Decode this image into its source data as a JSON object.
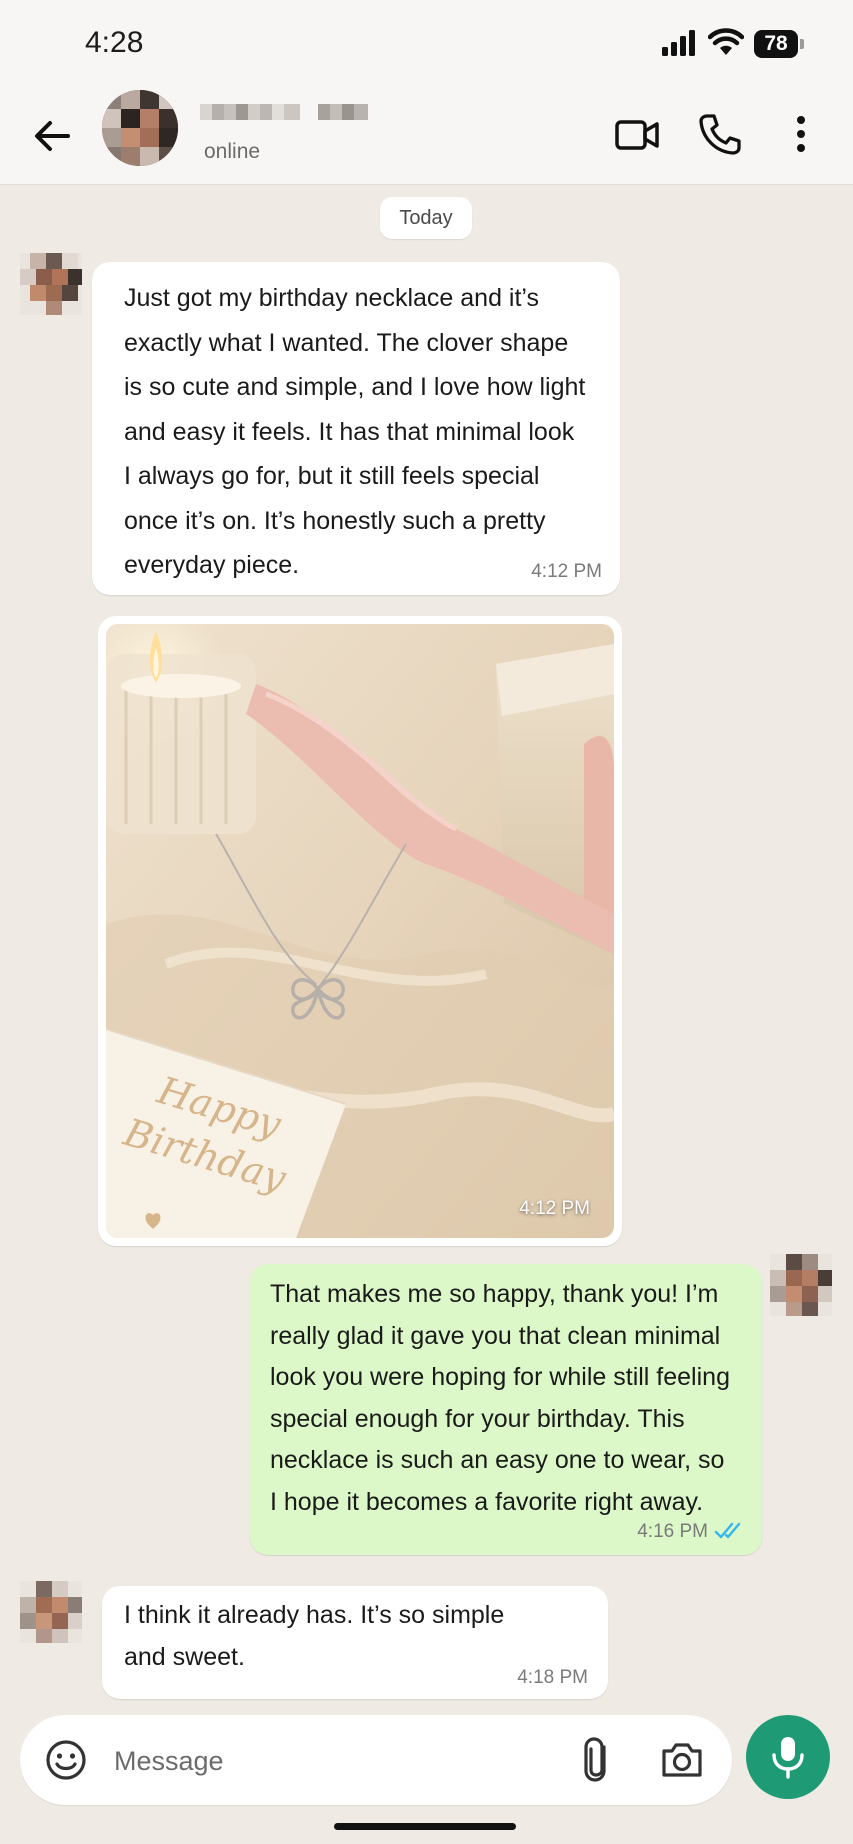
{
  "status_bar": {
    "time": "4:28",
    "battery": "78"
  },
  "header": {
    "contact_status": "online",
    "icons": [
      "back-arrow-icon",
      "video-call-icon",
      "phone-icon",
      "more-vertical-icon"
    ]
  },
  "chat": {
    "date_chip": "Today",
    "messages": [
      {
        "direction": "in",
        "lines": [
          "Just got my birthday necklace and it’s",
          "exactly what I wanted. The clover shape",
          "is so cute and simple, and I love how light",
          "and easy it feels. It has that minimal look",
          "I always go for, but it still feels special",
          "once it’s on. It’s honestly such a pretty",
          "everyday piece."
        ],
        "time": "4:12 PM"
      },
      {
        "direction": "in",
        "type": "image",
        "card_text_line1": "Happy",
        "card_text_line2": "Birthday",
        "time": "4:12 PM"
      },
      {
        "direction": "out",
        "lines": [
          "That makes me so happy, thank you! I’m",
          "really glad it gave you that clean minimal",
          "look you were hoping for while still feeling",
          "special enough for your birthday. This",
          "necklace is such an easy one to wear, so",
          "I hope it becomes a favorite right away."
        ],
        "time": "4:16 PM",
        "read_receipt": "double-check-icon",
        "read_color": "#34b7f1"
      },
      {
        "direction": "in",
        "lines": [
          "I think it already has. It’s so simple",
          "and sweet."
        ],
        "time": "4:18 PM"
      }
    ]
  },
  "composer": {
    "placeholder": "Message",
    "icons": [
      "emoji-icon",
      "paperclip-icon",
      "camera-icon",
      "microphone-icon"
    ],
    "accent": "#1e9b74"
  },
  "colors": {
    "chat_background": "#efeae3",
    "incoming_bubble": "#ffffff",
    "outgoing_bubble": "#dcf8c8"
  }
}
